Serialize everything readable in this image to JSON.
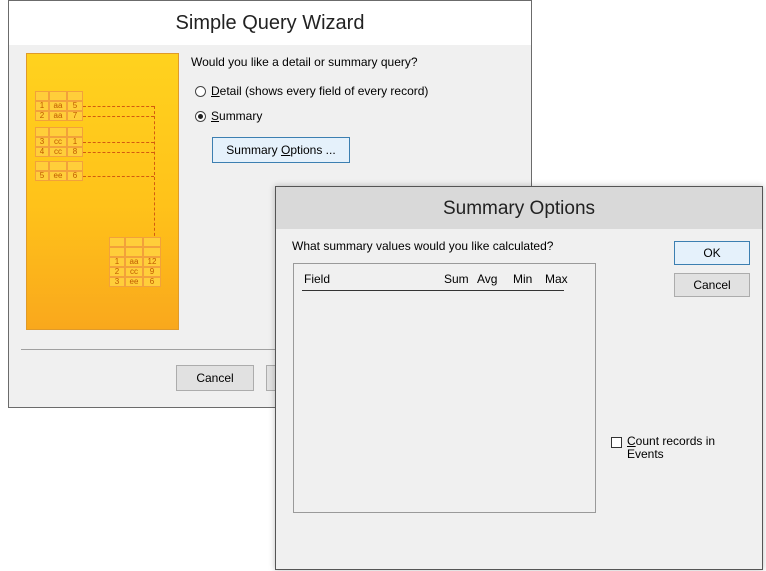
{
  "wizard": {
    "title": "Simple Query Wizard",
    "question": "Would you like a detail or summary query?",
    "options": [
      {
        "hotkey": "D",
        "rest": "etail (shows every field of every record)",
        "selected": false
      },
      {
        "hotkey": "S",
        "rest": "ummary",
        "selected": true
      }
    ],
    "summary_options_button": {
      "before": "Summary ",
      "hotkey": "O",
      "after": "ptions ..."
    },
    "cancel_label": "Cancel",
    "illustration": {
      "left_rows": [
        [
          "1",
          "aa",
          "5"
        ],
        [
          "2",
          "aa",
          "7"
        ],
        [
          "3",
          "cc",
          "1"
        ],
        [
          "4",
          "cc",
          "8"
        ],
        [
          "5",
          "ee",
          "6"
        ]
      ],
      "right_rows": [
        [
          "1",
          "aa",
          "12"
        ],
        [
          "2",
          "cc",
          "9"
        ],
        [
          "3",
          "ee",
          "6"
        ]
      ]
    }
  },
  "summary_dialog": {
    "title": "Summary Options",
    "question": "What summary values would you like calculated?",
    "columns": {
      "field": "Field",
      "sum": "Sum",
      "avg": "Avg",
      "min": "Min",
      "max": "Max"
    },
    "ok_label": "OK",
    "cancel_label": "Cancel",
    "count_records": {
      "hotkey": "C",
      "rest": "ount records in",
      "line2": "Events",
      "checked": false
    }
  },
  "colors": {
    "dialog_bg": "#f0f0f0",
    "illustration_yellow": "#ffc21a",
    "illustration_orange": "#f9a81c",
    "focus_border": "#3c7fb1"
  }
}
